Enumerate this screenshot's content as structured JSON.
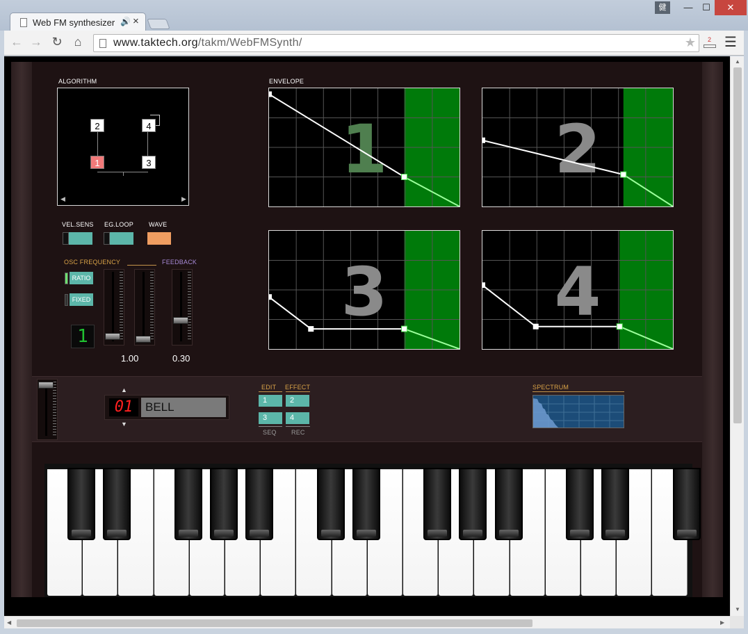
{
  "browser": {
    "tab_title": "Web FM synthesizer",
    "tab_speaker": "🔊",
    "tab_close": "×",
    "user_badge": "健",
    "win_min": "—",
    "win_max": "☐",
    "win_close": "✕",
    "url_host": "www.taktech.org",
    "url_path": "/takm/WebFMSynth/",
    "extension_badge": "2"
  },
  "synth": {
    "algorithm_label": "ALGORITHM",
    "operators": [
      "2",
      "4",
      "1",
      "3"
    ],
    "envelope_label": "ENVELOPE",
    "envelopes": [
      {
        "number": "1",
        "points": [
          [
            0.0,
            0.05
          ],
          [
            0.71,
            0.75
          ],
          [
            1.0,
            1.0
          ]
        ],
        "sustain_start": 0.71
      },
      {
        "number": "2",
        "points": [
          [
            0.0,
            0.44
          ],
          [
            0.74,
            0.73
          ],
          [
            1.0,
            1.0
          ]
        ],
        "sustain_start": 0.74
      },
      {
        "number": "3",
        "points": [
          [
            0.0,
            0.56
          ],
          [
            0.22,
            0.83
          ],
          [
            0.71,
            0.83
          ],
          [
            1.0,
            1.0
          ]
        ],
        "sustain_start": 0.71
      },
      {
        "number": "4",
        "points": [
          [
            0.0,
            0.46
          ],
          [
            0.28,
            0.81
          ],
          [
            0.72,
            0.81
          ],
          [
            1.0,
            1.0
          ]
        ],
        "sustain_start": 0.72
      }
    ],
    "switch_labels": {
      "vel_sens": "VEL.SENS",
      "eg_loop": "EG.LOOP",
      "wave": "WAVE"
    },
    "osc_frequency_label": "OSC FREQUENCY",
    "feedback_label": "FEEDBACK",
    "ratio_label": "RATIO",
    "fixed_label": "FIXED",
    "osc_digit": "1",
    "frequency_value": "1.00",
    "feedback_value": "0.30",
    "slider_levels": {
      "coarse": 0.06,
      "fine": 0.02,
      "feedback": 0.3,
      "master": 0.95
    },
    "preset_number": "01",
    "preset_name": "BELL",
    "preset_up": "▲",
    "preset_down": "▼",
    "mode_labels": {
      "edit": "EDIT",
      "effect": "EFFECT",
      "seq": "SEQ",
      "rec": "REC"
    },
    "mode_buttons": [
      "1",
      "2",
      "3",
      "4"
    ],
    "spectrum_label": "SPECTRUM"
  },
  "colors": {
    "teal": "#5cb6a9",
    "orange": "#ef9d61",
    "carrier": "#f27a7a",
    "gold": "#d8a247",
    "purple": "#a78ad7",
    "sustain_green": "#007a0a"
  }
}
